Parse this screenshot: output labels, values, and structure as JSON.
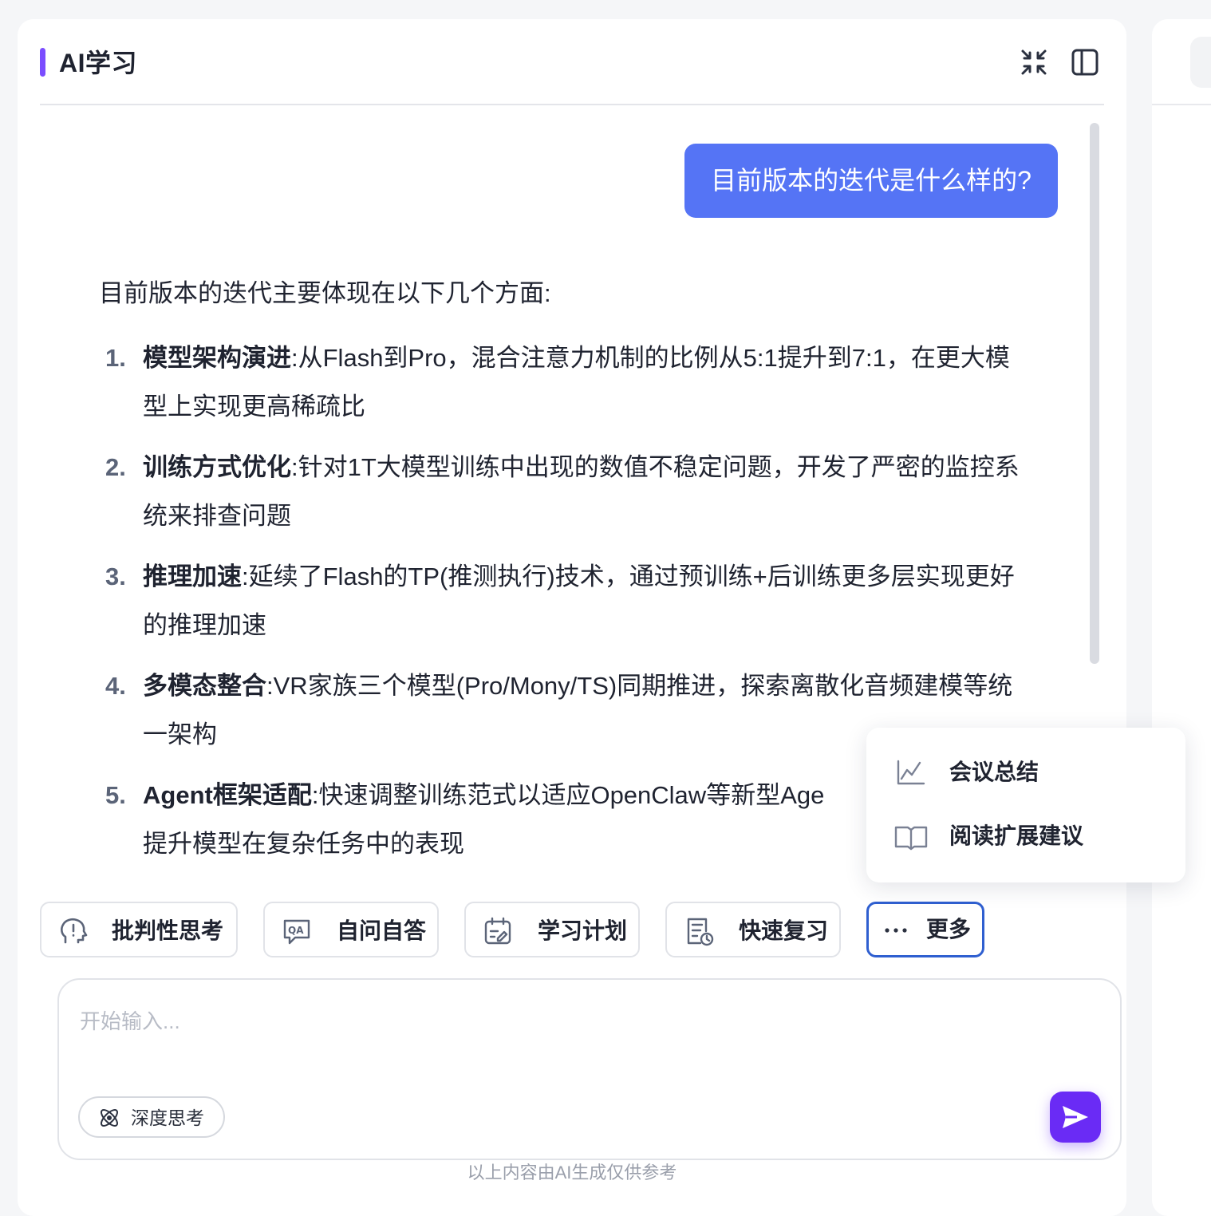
{
  "header": {
    "title": "AI学习"
  },
  "chat": {
    "user_question": "目前版本的迭代是什么样的?",
    "answer_intro": "目前版本的迭代主要体现在以下几个方面:",
    "answer_items": [
      {
        "num": "1.",
        "title": "模型架构演进",
        "sep": ":",
        "text": "从Flash到Pro，混合注意力机制的比例从5:1提升到7:1，在更大模型上实现更高稀疏比"
      },
      {
        "num": "2.",
        "title": "训练方式优化",
        "sep": ":",
        "text": "针对1T大模型训练中出现的数值不稳定问题，开发了严密的监控系统来排查问题"
      },
      {
        "num": "3.",
        "title": "推理加速",
        "sep": ":",
        "text": "延续了Flash的TP(推测执行)技术，通过预训练+后训练更多层实现更好的推理加速"
      },
      {
        "num": "4.",
        "title": "多模态整合",
        "sep": ":",
        "text": "VR家族三个模型(Pro/Mony/TS)同期推进，探索离散化音频建模等统一架构"
      },
      {
        "num": "5.",
        "title": "Agent框架适配",
        "sep": ":",
        "text": "快速调整训练范式以适应OpenClaw等新型Age"
      },
      {
        "num": "",
        "title": "",
        "sep": "",
        "text": "提升模型在复杂任务中的表现"
      }
    ]
  },
  "more_menu": {
    "items": [
      {
        "label": "会议总结",
        "icon": "line-chart-icon"
      },
      {
        "label": "阅读扩展建议",
        "icon": "open-book-icon"
      }
    ]
  },
  "quick_actions": {
    "critical_thinking": "批判性思考",
    "self_qa": "自问自答",
    "study_plan": "学习计划",
    "quick_review": "快速复习",
    "more": "更多"
  },
  "composer": {
    "placeholder": "开始输入...",
    "deep_think": "深度思考"
  },
  "footer": {
    "disclaimer": "以上内容由AI生成仅供参考"
  },
  "colors": {
    "accent": "#7b4dff",
    "user_bubble": "#5574f5",
    "send_button": "#6a2bf5",
    "more_border": "#2f5fd0"
  }
}
